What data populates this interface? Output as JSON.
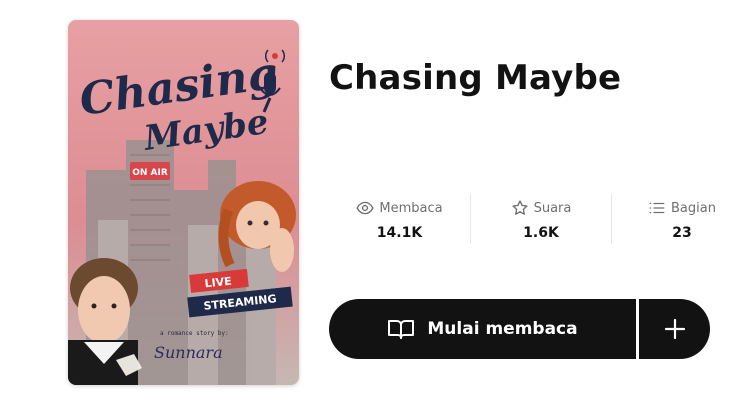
{
  "story": {
    "title": "Chasing Maybe",
    "cover": {
      "title_line1": "Chasing",
      "title_line2": "Maybe",
      "on_air_sign": "ON AIR",
      "live_label": "LIVE",
      "streaming_label": "STREAMING",
      "byline": "a romance story by:",
      "author_signature": "Sunnara"
    }
  },
  "stats": [
    {
      "icon": "eye-icon",
      "label": "Membaca",
      "value": "14.1K"
    },
    {
      "icon": "star-icon",
      "label": "Suara",
      "value": "1.6K"
    },
    {
      "icon": "list-icon",
      "label": "Bagian",
      "value": "23"
    }
  ],
  "actions": {
    "start_reading_label": "Mulai membaca",
    "add_icon": "plus-icon"
  },
  "colors": {
    "button_bg": "#121212",
    "cover_pink": "#e8989f",
    "cover_navy": "#1f2a4a",
    "live_red": "#d83a3a"
  }
}
